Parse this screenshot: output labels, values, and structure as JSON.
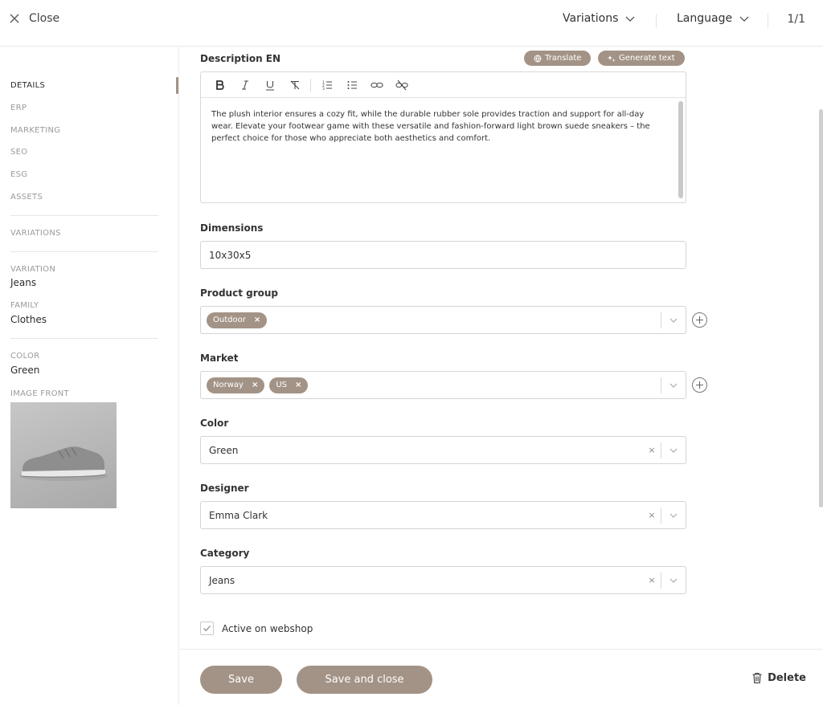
{
  "topbar": {
    "close_label": "Close",
    "variations_label": "Variations",
    "language_label": "Language",
    "pager": "1/1"
  },
  "sidebar": {
    "nav": [
      "DETAILS",
      "ERP",
      "MARKETING",
      "SEO",
      "ESG",
      "ASSETS"
    ],
    "variations_link": "VARIATIONS",
    "meta": {
      "variation_label": "VARIATION",
      "variation_value": "Jeans",
      "family_label": "FAMILY",
      "family_value": "Clothes",
      "color_label": "COLOR",
      "color_value": "Green",
      "image_front_label": "IMAGE FRONT"
    }
  },
  "description": {
    "label": "Description EN",
    "translate_label": "Translate",
    "generate_label": "Generate text",
    "toolbar_icons": [
      "bold-icon",
      "italic-icon",
      "underline-icon",
      "clear-format-icon",
      "ordered-list-icon",
      "bullet-list-icon",
      "link-icon",
      "unlink-icon"
    ],
    "body": "The plush interior ensures a cozy fit, while the durable rubber sole provides traction and support for all-day wear. Elevate your footwear game with these versatile and fashion-forward light brown suede sneakers – the perfect choice for those who appreciate both aesthetics and comfort."
  },
  "dimensions": {
    "label": "Dimensions",
    "value": "10x30x5"
  },
  "product_group": {
    "label": "Product group",
    "tags": [
      "Outdoor"
    ]
  },
  "market": {
    "label": "Market",
    "tags": [
      "Norway",
      "US"
    ]
  },
  "color": {
    "label": "Color",
    "value": "Green"
  },
  "designer": {
    "label": "Designer",
    "value": "Emma Clark"
  },
  "category": {
    "label": "Category",
    "value": "Jeans"
  },
  "active_webshop": {
    "label": "Active on webshop",
    "checked": true
  },
  "footer": {
    "save_label": "Save",
    "save_close_label": "Save and close",
    "delete_label": "Delete"
  },
  "colors": {
    "accent": "#a39386",
    "border": "#d4d4d4",
    "muted_text": "#9a9a9a"
  }
}
